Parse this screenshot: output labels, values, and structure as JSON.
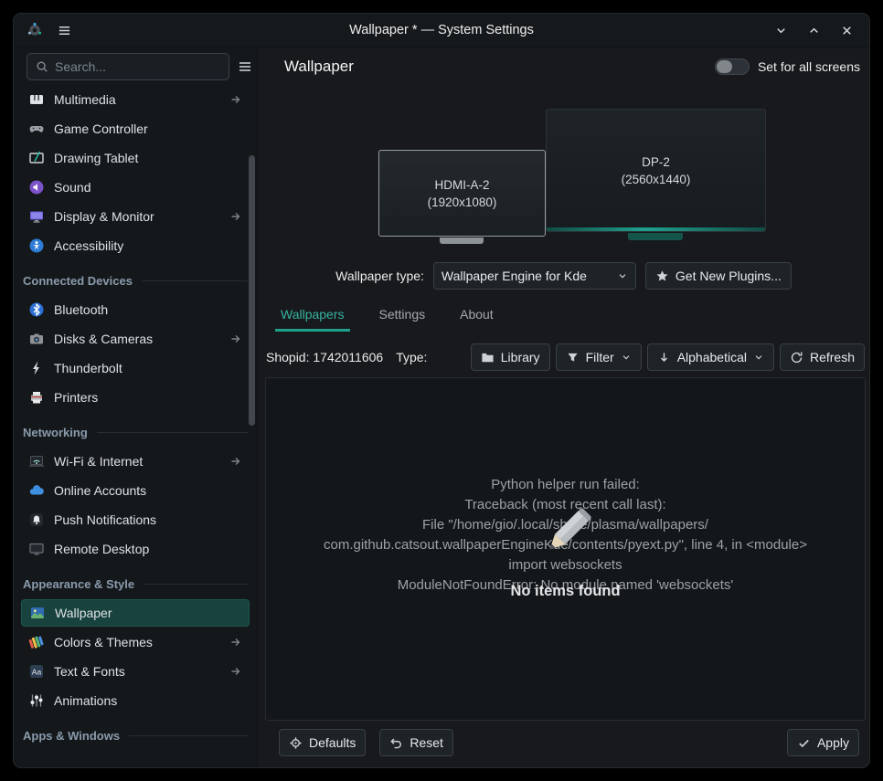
{
  "colors": {
    "accent": "#1fa18e",
    "selection_bg": "#17423d"
  },
  "titlebar": {
    "title": "Wallpaper * — System Settings"
  },
  "sidebar": {
    "search_placeholder": "Search...",
    "items": [
      {
        "label": "Multimedia",
        "type": "item",
        "arrow": true
      },
      {
        "label": "Game Controller",
        "type": "item"
      },
      {
        "label": "Drawing Tablet",
        "type": "item"
      },
      {
        "label": "Sound",
        "type": "item"
      },
      {
        "label": "Display & Monitor",
        "type": "item",
        "arrow": true
      },
      {
        "label": "Accessibility",
        "type": "item"
      },
      {
        "label": "Connected Devices",
        "type": "header"
      },
      {
        "label": "Bluetooth",
        "type": "item"
      },
      {
        "label": "Disks & Cameras",
        "type": "item",
        "arrow": true
      },
      {
        "label": "Thunderbolt",
        "type": "item"
      },
      {
        "label": "Printers",
        "type": "item"
      },
      {
        "label": "Networking",
        "type": "header"
      },
      {
        "label": "Wi-Fi & Internet",
        "type": "item",
        "arrow": true
      },
      {
        "label": "Online Accounts",
        "type": "item"
      },
      {
        "label": "Push Notifications",
        "type": "item"
      },
      {
        "label": "Remote Desktop",
        "type": "item"
      },
      {
        "label": "Appearance & Style",
        "type": "header"
      },
      {
        "label": "Wallpaper",
        "type": "item",
        "selected": true
      },
      {
        "label": "Colors & Themes",
        "type": "item",
        "arrow": true
      },
      {
        "label": "Text & Fonts",
        "type": "item",
        "arrow": true
      },
      {
        "label": "Animations",
        "type": "item"
      },
      {
        "label": "Apps & Windows",
        "type": "header"
      }
    ]
  },
  "header": {
    "title": "Wallpaper",
    "toggle_label": "Set for all screens"
  },
  "monitors": [
    {
      "name": "HDMI-A-2",
      "resolution": "(1920x1080)",
      "selected": true
    },
    {
      "name": "DP-2",
      "resolution": "(2560x1440)",
      "selected": false
    }
  ],
  "wallpaper_type": {
    "label": "Wallpaper type:",
    "value": "Wallpaper Engine for Kde",
    "get_new_plugins": "Get New Plugins..."
  },
  "tabs": [
    {
      "label": "Wallpapers",
      "selected": true
    },
    {
      "label": "Settings",
      "selected": false
    },
    {
      "label": "About",
      "selected": false
    }
  ],
  "toolbar": {
    "shopid_label": "Shopid: 1742011606",
    "type_label": "Type:",
    "library": "Library",
    "filter": "Filter",
    "sort": "Alphabetical",
    "refresh": "Refresh"
  },
  "error_view": {
    "lines": [
      "Python helper run failed:",
      "Traceback (most recent call last):",
      "File \"/home/gio/.local/share/plasma/wallpapers/",
      "com.github.catsout.wallpaperEngineKde/contents/pyext.py\", line 4, in <module>",
      "import websockets",
      "ModuleNotFoundError: No module named 'websockets'"
    ],
    "placeholder": "No items found"
  },
  "footer": {
    "defaults": "Defaults",
    "reset": "Reset",
    "apply": "Apply"
  }
}
